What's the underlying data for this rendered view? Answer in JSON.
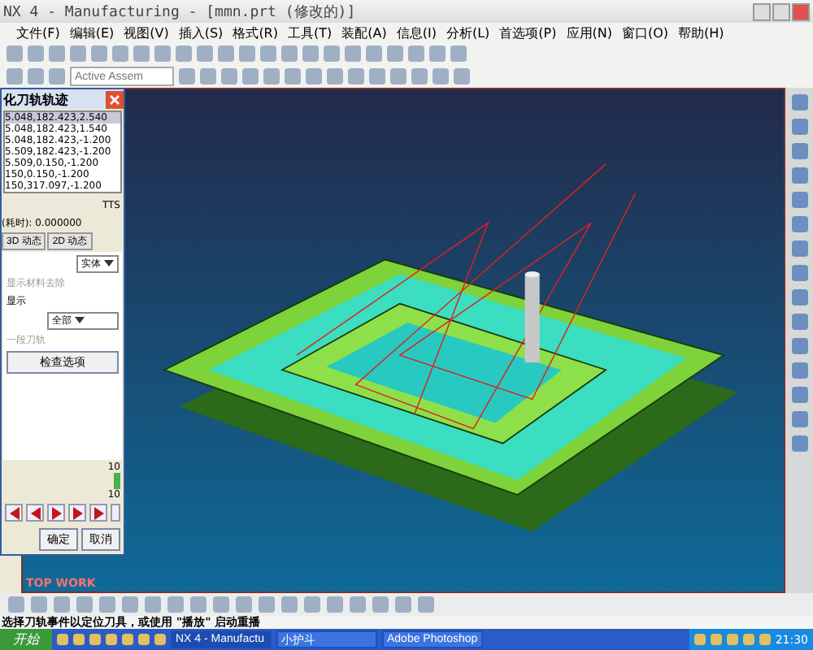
{
  "window": {
    "title": "NX 4 - Manufacturing - [mmn.prt (修改的)]"
  },
  "menu": [
    "文件(F)",
    "编辑(E)",
    "视图(V)",
    "插入(S)",
    "格式(R)",
    "工具(T)",
    "装配(A)",
    "信息(I)",
    "分析(L)",
    "首选项(P)",
    "应用(N)",
    "窗口(O)",
    "帮助(H)"
  ],
  "toolbar_fields": [
    {
      "placeholder": "Active Assem"
    }
  ],
  "dialog": {
    "title": "化刀轨轨迹",
    "rows": [
      {
        "text": "5.048,182.423,2.540",
        "selected": true
      },
      {
        "text": "5.048,182.423,1.540",
        "selected": false
      },
      {
        "text": "5.048,182.423,-1.200",
        "selected": false
      },
      {
        "text": "5.509,182.423,-1.200",
        "selected": false
      },
      {
        "text": "5.509,0.150,-1.200",
        "selected": false
      },
      {
        "text": "150,0.150,-1.200",
        "selected": false
      },
      {
        "text": "150,317.097,-1.200",
        "selected": false
      }
    ],
    "side_value": "TTS",
    "time_label": "(耗时): 0.000000",
    "tabs": [
      {
        "label": "3D 动态",
        "selected": false
      },
      {
        "label": "2D 动态",
        "selected": false
      }
    ],
    "display_select": "实体",
    "display_note": "显示材料去除",
    "scope_label": "显示",
    "scope_select": "全部",
    "hint": "一段刀轨",
    "check_button": "检查选项",
    "speed_max": "10",
    "speed": "10",
    "speed_slider": {
      "level": 1
    },
    "ok": "确定",
    "cancel": "取消"
  },
  "viewport": {
    "label": "TOP WORK"
  },
  "status": "选择刀轨事件以定位刀具，或使用 \"播放\" 启动重播",
  "taskbar": {
    "start": "开始",
    "tasks": [
      {
        "label": "NX 4 - Manufactu",
        "selected": true
      },
      {
        "label": "小护斗",
        "selected": false
      },
      {
        "label": "Adobe Photoshop",
        "selected": false
      }
    ],
    "clock": "21:30"
  }
}
